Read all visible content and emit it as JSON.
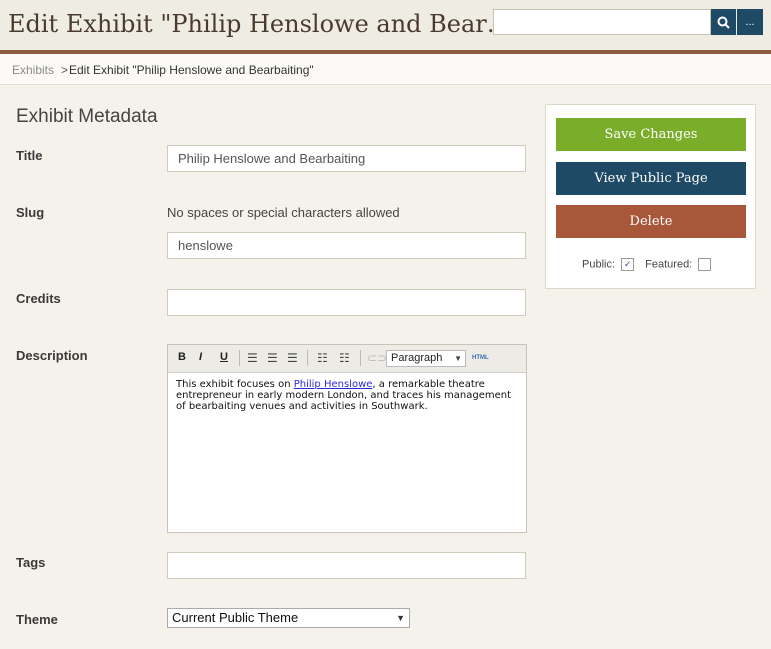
{
  "header": {
    "title": "Edit Exhibit \"Philip Henslowe and Bear…",
    "search": {
      "value": "",
      "placeholder": ""
    },
    "more_label": "..."
  },
  "breadcrumb": {
    "link": "Exhibits",
    "separator": ">",
    "current": "Edit Exhibit \"Philip Henslowe and Bearbaiting\""
  },
  "form": {
    "section_title": "Exhibit Metadata",
    "title_label": "Title",
    "title_value": "Philip Henslowe and Bearbaiting",
    "slug_label": "Slug",
    "slug_hint": "No spaces or special characters allowed",
    "slug_value": "henslowe",
    "credits_label": "Credits",
    "credits_value": "",
    "description_label": "Description",
    "tags_label": "Tags",
    "tags_value": "",
    "theme_label": "Theme",
    "theme_value": "Current Public Theme"
  },
  "editor": {
    "bold": "B",
    "italic": "I",
    "underline": "U",
    "format": "Paragraph",
    "html_label": "HTML",
    "text_before": "This exhibit focuses on ",
    "link_text": "Philip Henslowe",
    "text_after": ", a remarkable theatre entrepreneur in early modern London, and traces his management of bearbaiting venues and activities in Southwark."
  },
  "panel": {
    "save_label": "Save Changes",
    "view_label": "View Public Page",
    "delete_label": "Delete",
    "public_label": "Public:",
    "public_checked": true,
    "featured_label": "Featured:",
    "featured_checked": false
  },
  "colors": {
    "save": "#7aae2a",
    "view": "#1f4a66",
    "delete": "#a9573b",
    "header_bar": "#8d5a3b"
  }
}
